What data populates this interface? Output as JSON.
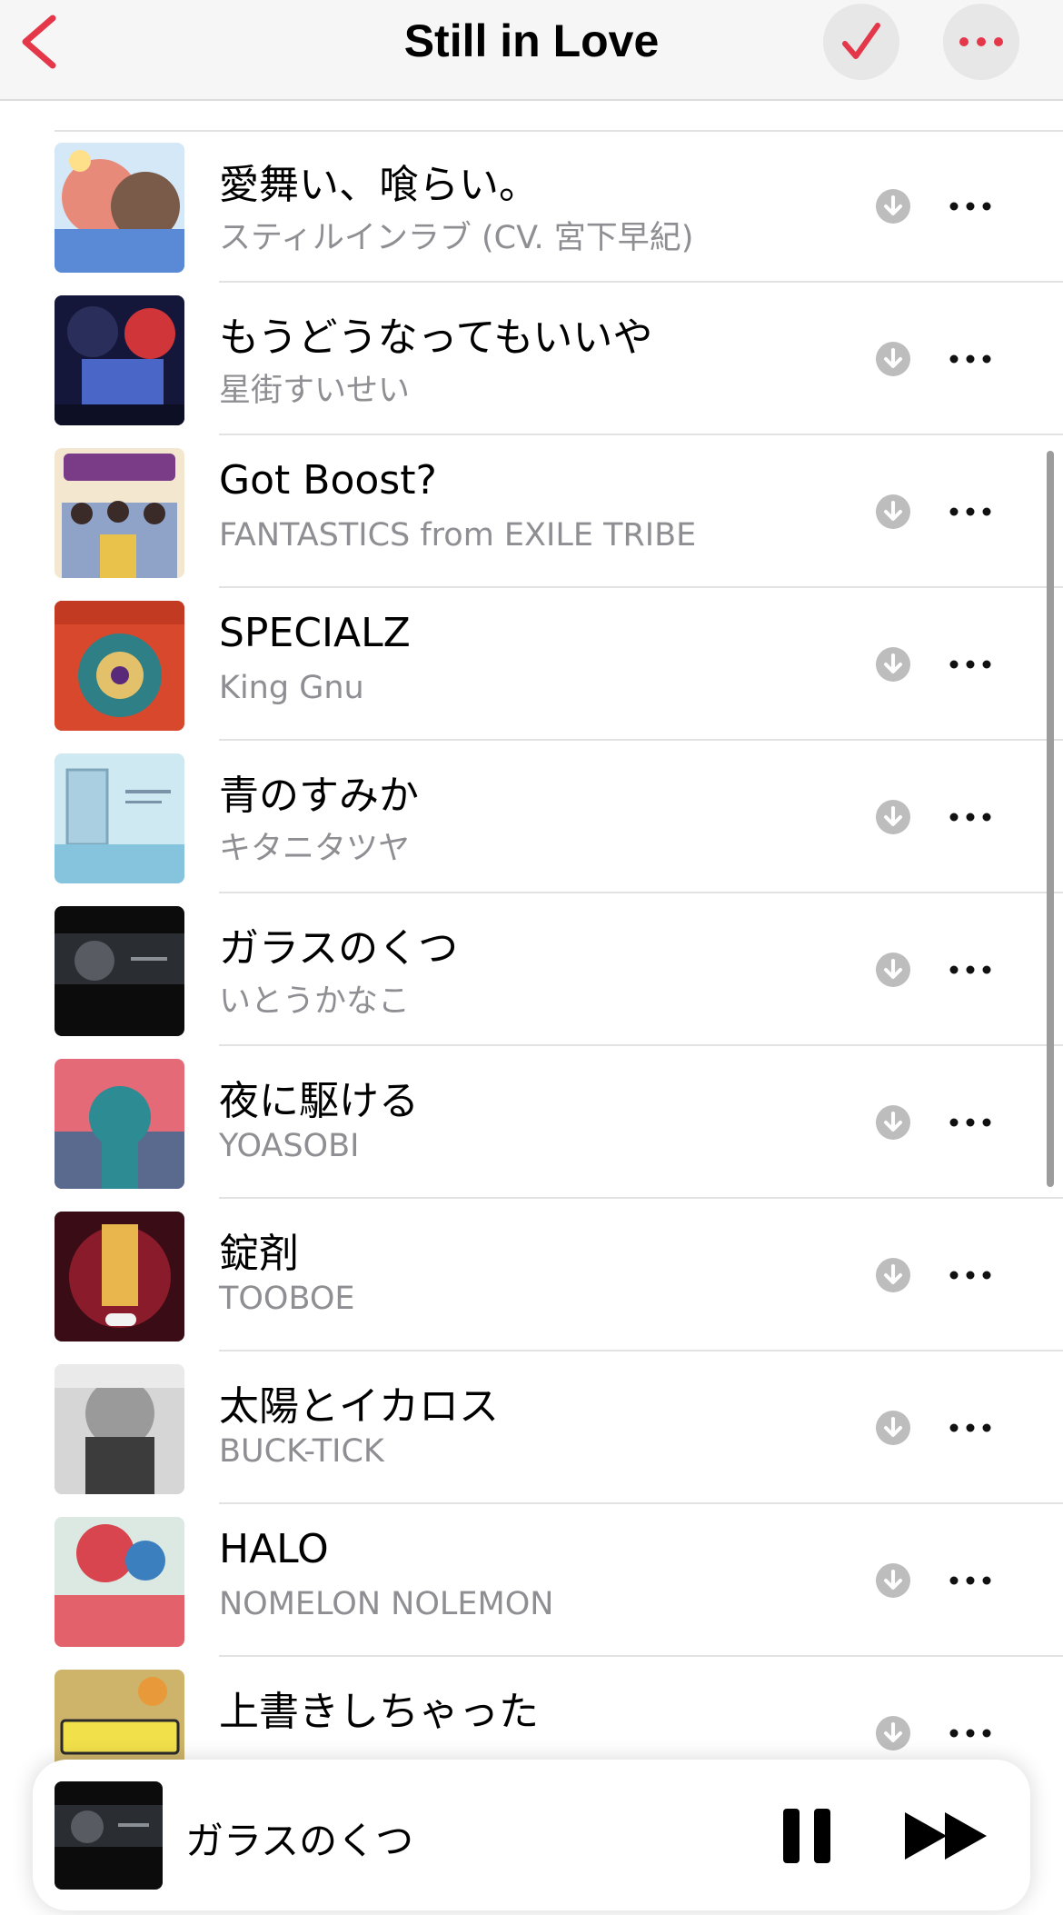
{
  "nav": {
    "title": "Still in Love",
    "back_icon": "chevron-left-icon",
    "accent": "#e5374a"
  },
  "songs": [
    {
      "title": "愛舞い、喰らい。",
      "artist": "スティルインラブ (CV. 宮下早紀)"
    },
    {
      "title": "もうどうなってもいいや",
      "artist": "星街すいせい"
    },
    {
      "title": "Got Boost?",
      "artist": "FANTASTICS from EXILE TRIBE"
    },
    {
      "title": "SPECIALZ",
      "artist": "King Gnu"
    },
    {
      "title": "青のすみか",
      "artist": "キタニタツヤ"
    },
    {
      "title": "ガラスのくつ",
      "artist": "いとうかなこ"
    },
    {
      "title": "夜に駆ける",
      "artist": "YOASOBI"
    },
    {
      "title": "錠剤",
      "artist": "TOOBOE"
    },
    {
      "title": "太陽とイカロス",
      "artist": "BUCK-TICK"
    },
    {
      "title": "HALO",
      "artist": "NOMELON NOLEMON"
    },
    {
      "title": "上書きしちゃった",
      "artist": ""
    }
  ],
  "mini_player": {
    "title": "ガラスのくつ"
  }
}
